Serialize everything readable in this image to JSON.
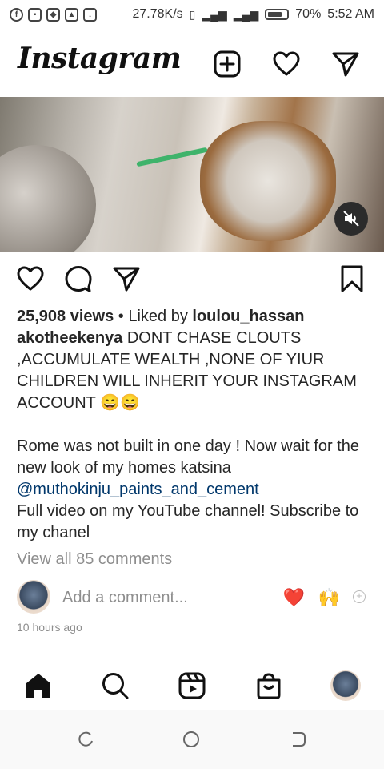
{
  "status_bar": {
    "speed": "27.78K/s",
    "battery_pct": "70%",
    "time": "5:52 AM"
  },
  "header": {
    "logo": "Instagram",
    "icons": [
      "new-post-icon",
      "heart-icon",
      "direct-message-icon"
    ]
  },
  "post": {
    "video_muted": true,
    "views": "25,908 views",
    "liked_by_prefix": " • Liked by ",
    "liked_by_user": "loulou_hassan",
    "author": "akotheekenya",
    "caption_1": " DONT CHASE CLOUTS ,ACCUMULATE WEALTH ,NONE OF YIUR CHILDREN WILL INHERIT YOUR INSTAGRAM ACCOUNT 😄😄",
    "caption_2": "Rome was not built in one day ! Now wait for the new look of my homes katsina",
    "mention": "@muthokinju_paints_and_cement",
    "caption_3": "Full video on my YouTube channel! Subscribe to my chanel",
    "view_comments": "View all 85 comments",
    "add_comment_placeholder": "Add a comment...",
    "quick_emojis": [
      "❤️",
      "🙌"
    ],
    "timestamp": "10 hours ago"
  },
  "bottom_nav": [
    "home-icon",
    "search-icon",
    "reels-icon",
    "shop-icon",
    "profile-avatar"
  ],
  "system_nav": [
    "recent-apps",
    "home",
    "back"
  ]
}
